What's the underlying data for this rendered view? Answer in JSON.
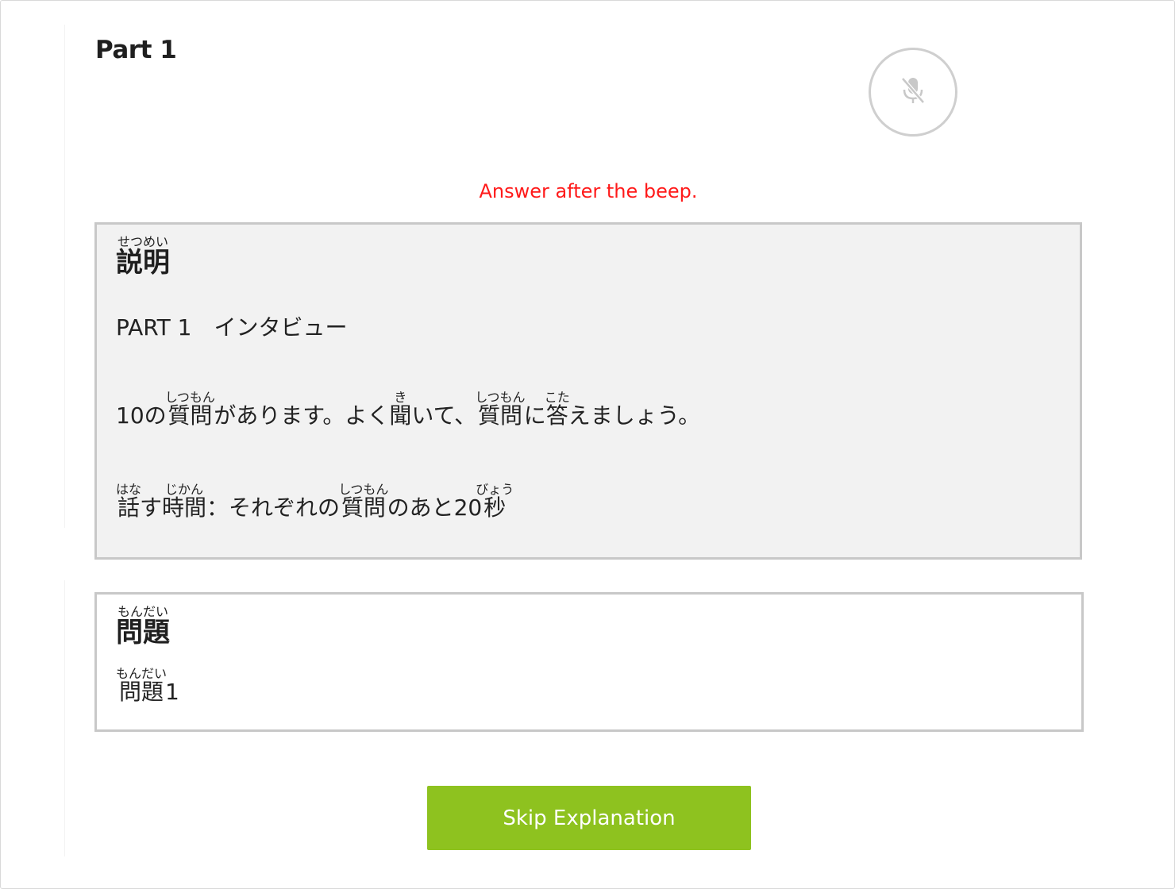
{
  "part_title": "Part 1",
  "mic": {
    "icon": "microphone-muted-icon",
    "color": "#c8c8c8"
  },
  "notice": {
    "text": "Answer after the beep.",
    "color": "#ff1a1a"
  },
  "explanation": {
    "heading": {
      "kanji": "説明",
      "reading": "せつめい"
    },
    "section_label": "PART 1　インタビュー",
    "instruction": {
      "prefix": "10の",
      "kanji1": "質問",
      "reading1": "しつもん",
      "mid1": "があります。よく",
      "kanji2": "聞",
      "reading2": "き",
      "mid2": "いて、",
      "kanji3": "質問",
      "reading3": "しつもん",
      "mid3": "に",
      "kanji4": "答",
      "reading4": "こた",
      "suffix": "えましょう。"
    },
    "time": {
      "kanji1": "話",
      "reading1": "はな",
      "mid1": "す",
      "kanji2": "時間",
      "reading2": "じかん",
      "mid2": "：それぞれの",
      "kanji3": "質問",
      "reading3": "しつもん",
      "mid3": "のあと20",
      "kanji4": "秒",
      "reading4": "びょう"
    }
  },
  "question": {
    "heading": {
      "kanji": "問題",
      "reading": "もんだい"
    },
    "item": {
      "kanji": "問題",
      "reading": "もんだい",
      "number": "1"
    }
  },
  "skip_button": {
    "label": "Skip Explanation",
    "color": "#8ec21f"
  }
}
